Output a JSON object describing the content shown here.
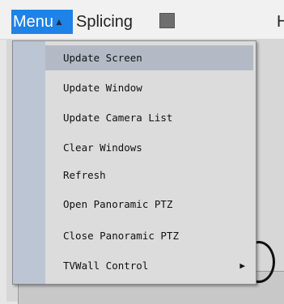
{
  "topbar": {
    "menu_label": "Menu",
    "menu_arrow": "▲",
    "splicing_label": "Splicing",
    "right_partial": "H"
  },
  "menu": {
    "items": [
      {
        "label": "Update Screen",
        "highlighted": true
      },
      {
        "label": "Update Window"
      },
      {
        "label": "Update Camera List"
      },
      {
        "label": "Clear Windows"
      },
      {
        "label": "Refresh"
      },
      {
        "label": "Open Panoramic PTZ"
      },
      {
        "label": "Close Panoramic PTZ"
      },
      {
        "label": "TVWall Control",
        "submenu_arrow": "▶"
      }
    ]
  },
  "colors": {
    "accent": "#1e82e6",
    "menu_bg": "#dcdcdc",
    "gutter": "#bcc5d3",
    "highlight": "#b3bac6"
  }
}
